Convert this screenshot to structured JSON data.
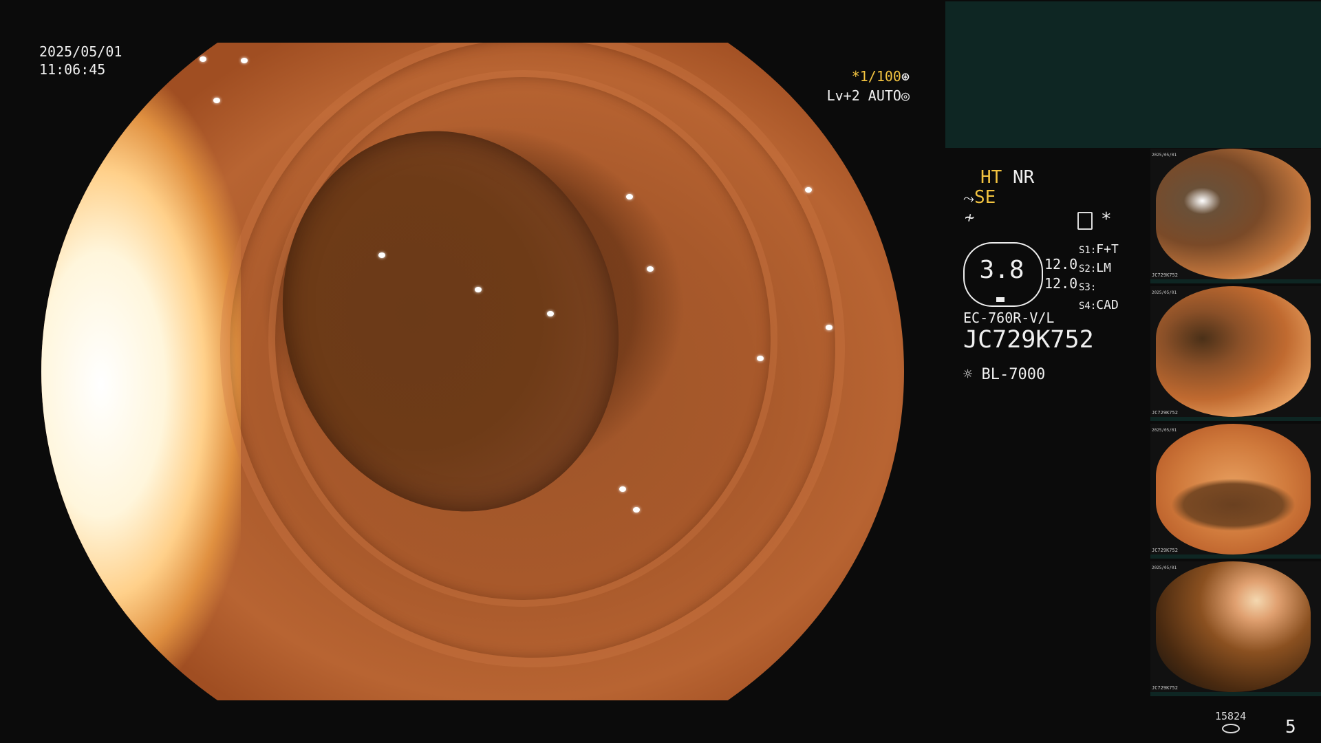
{
  "overlay": {
    "date": "2025/05/01",
    "time": "11:06:45",
    "shutter": "*1/100",
    "shutter_icon": "aperture-icon",
    "level": "Lv+2 AUTO",
    "level_icon": "iris-icon"
  },
  "settings": {
    "ht": "HT",
    "nr": "NR",
    "se": "SE",
    "zoom_value": "3.8",
    "value_top": "12.0",
    "value_bottom": "12.0",
    "slots": [
      {
        "key": "S1:",
        "value": "F+T"
      },
      {
        "key": "S2:",
        "value": "LM"
      },
      {
        "key": "S3:",
        "value": ""
      },
      {
        "key": "S4:",
        "value": "CAD"
      }
    ],
    "scope_model": "EC-760R-V/L",
    "serial": "JC729K752",
    "light_source": "BL-7000"
  },
  "thumbnails": [
    {
      "label_top": "2025/05/01",
      "label_bottom": "JC729K752"
    },
    {
      "label_top": "2025/05/01",
      "label_bottom": "JC729K752"
    },
    {
      "label_top": "2025/05/01",
      "label_bottom": "JC729K752"
    },
    {
      "label_top": "2025/05/01",
      "label_bottom": "JC729K752"
    }
  ],
  "footer": {
    "storage_count": "15824",
    "page_number": "5"
  },
  "colors": {
    "accent_yellow": "#f2c340",
    "panel_teal": "#0e2623",
    "tissue": "#a8592b"
  }
}
